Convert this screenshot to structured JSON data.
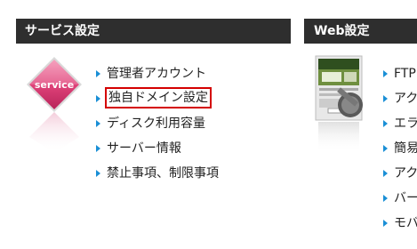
{
  "left_panel": {
    "title": "サービス設定",
    "icon_text": "service",
    "items": [
      {
        "label": "管理者アカウント"
      },
      {
        "label": "独自ドメイン設定"
      },
      {
        "label": "ディスク利用容量"
      },
      {
        "label": "サーバー情報"
      },
      {
        "label": "禁止事項、制限事項"
      }
    ]
  },
  "right_panel": {
    "title": "Web設定",
    "items": [
      {
        "label": "FTP"
      },
      {
        "label": "アク"
      },
      {
        "label": "エラ"
      },
      {
        "label": "簡易"
      },
      {
        "label": "アク"
      },
      {
        "label": "バー"
      },
      {
        "label": "モバ"
      }
    ]
  },
  "colors": {
    "header_bg": "#2e2e2e",
    "arrow": "#1a8fd6",
    "highlight_border": "#d40000",
    "service_pink": "#e0437a"
  }
}
